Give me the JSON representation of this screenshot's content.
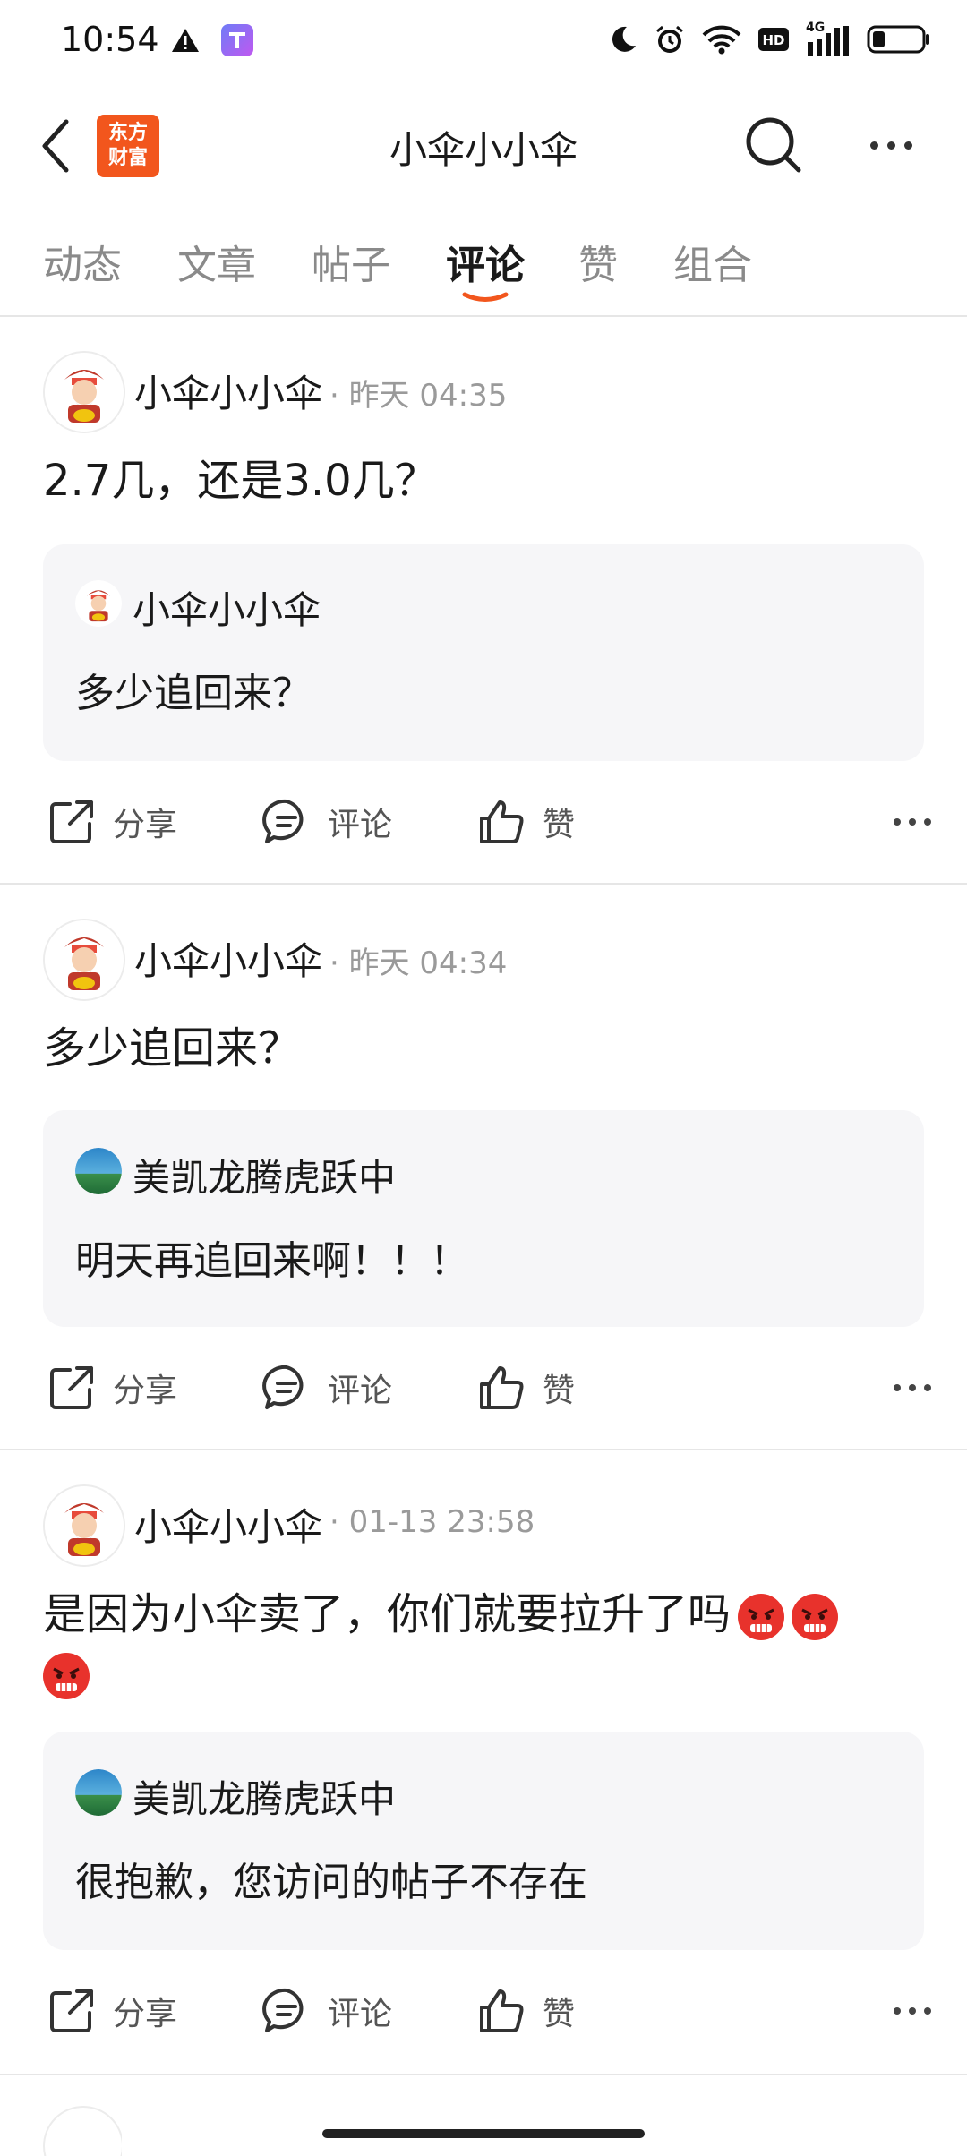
{
  "status_bar": {
    "time": "10:54",
    "network": "4G",
    "icons": [
      "warning-icon",
      "app-t-icon",
      "moon-icon",
      "alarm-icon",
      "wifi-icon",
      "hd-icon",
      "signal-icon",
      "battery-icon"
    ],
    "battery_level": 0.25
  },
  "nav": {
    "title": "小伞小小伞",
    "logo_line1": "东方",
    "logo_line2": "财富"
  },
  "tabs": [
    {
      "label": "动态"
    },
    {
      "label": "文章"
    },
    {
      "label": "帖子"
    },
    {
      "label": "评论"
    },
    {
      "label": "赞"
    },
    {
      "label": "组合"
    }
  ],
  "active_tab": "评论",
  "colors": {
    "accent": "#f2561d",
    "quote_bg": "#f6f6f8",
    "angry_emoji": "#e8322c"
  },
  "posts": [
    {
      "author": "小伞小小伞",
      "time": "· 昨天 04:35",
      "content": "2.7几，还是3.0几？",
      "quote_author": "小伞小小伞",
      "quote_text": "多少追回来？"
    },
    {
      "author": "小伞小小伞",
      "time": "· 昨天 04:34",
      "content": "多少追回来？",
      "quote_author": "美凯龙腾虎跃中",
      "quote_text": "明天再追回来啊！！！"
    },
    {
      "author": "小伞小小伞",
      "time": "· 01-13 23:58",
      "content": "是因为小伞卖了，你们就要拉升了吗",
      "quote_author": "美凯龙腾虎跃中",
      "quote_text": "很抱歉，您访问的帖子不存在"
    }
  ],
  "actions": {
    "share": "分享",
    "comment": "评论",
    "like": "赞"
  }
}
